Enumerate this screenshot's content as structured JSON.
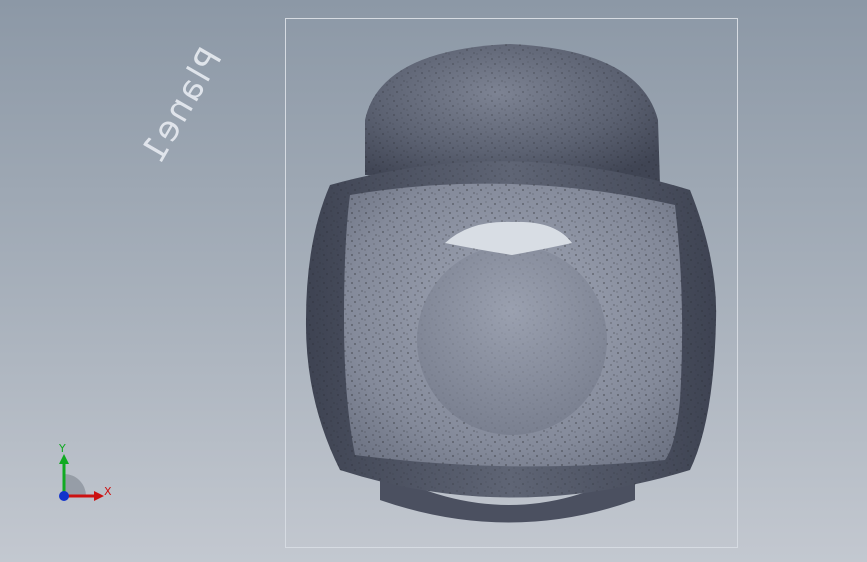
{
  "viewport": {
    "plane_label": "Plane1"
  },
  "triad": {
    "x_label": "X",
    "y_label": "Y",
    "x_color": "#cc1111",
    "y_color": "#11aa22",
    "z_color": "#1133cc"
  },
  "colors": {
    "background_top": "#8c98a6",
    "background_bottom": "#c3c8d0",
    "part_color": "#5a6070",
    "bounding_box": "#d6dbe2"
  }
}
